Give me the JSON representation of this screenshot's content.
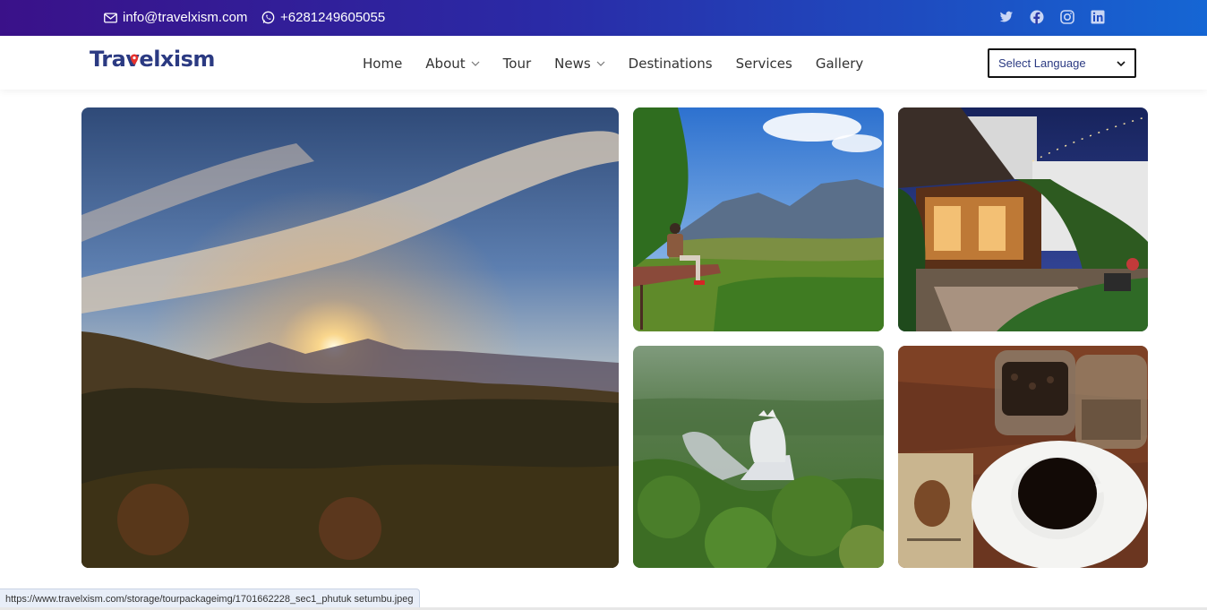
{
  "topbar": {
    "email": "info@travelxism.com",
    "phone": "+6281249605055",
    "social_icons": [
      "twitter-icon",
      "facebook-icon",
      "instagram-icon",
      "linkedin-icon"
    ]
  },
  "brand": {
    "name": "Travelxism",
    "color": "#2b3a82",
    "pin_color": "#e5322d"
  },
  "nav": {
    "items": [
      {
        "label": "Home",
        "dropdown": false
      },
      {
        "label": "About",
        "dropdown": true
      },
      {
        "label": "Tour",
        "dropdown": false
      },
      {
        "label": "News",
        "dropdown": true
      },
      {
        "label": "Destinations",
        "dropdown": false
      },
      {
        "label": "Services",
        "dropdown": false
      },
      {
        "label": "Gallery",
        "dropdown": false
      }
    ],
    "language_select": "Select Language"
  },
  "gallery": {
    "images": [
      {
        "description": "sunset-over-forest-hills"
      },
      {
        "description": "man-sitting-on-viewpoint-platform-mountains"
      },
      {
        "description": "javanese-joglo-cafe-at-night"
      },
      {
        "description": "chicken-church-in-forest"
      },
      {
        "description": "coffee-cup-and-bean-jars"
      }
    ]
  },
  "status": {
    "url": "https://www.travelxism.com/storage/tourpackageimg/1701662228_sec1_phutuk setumbu.jpeg"
  },
  "colors": {
    "topbar_start": "#3a1189",
    "topbar_end": "#1566d4"
  }
}
